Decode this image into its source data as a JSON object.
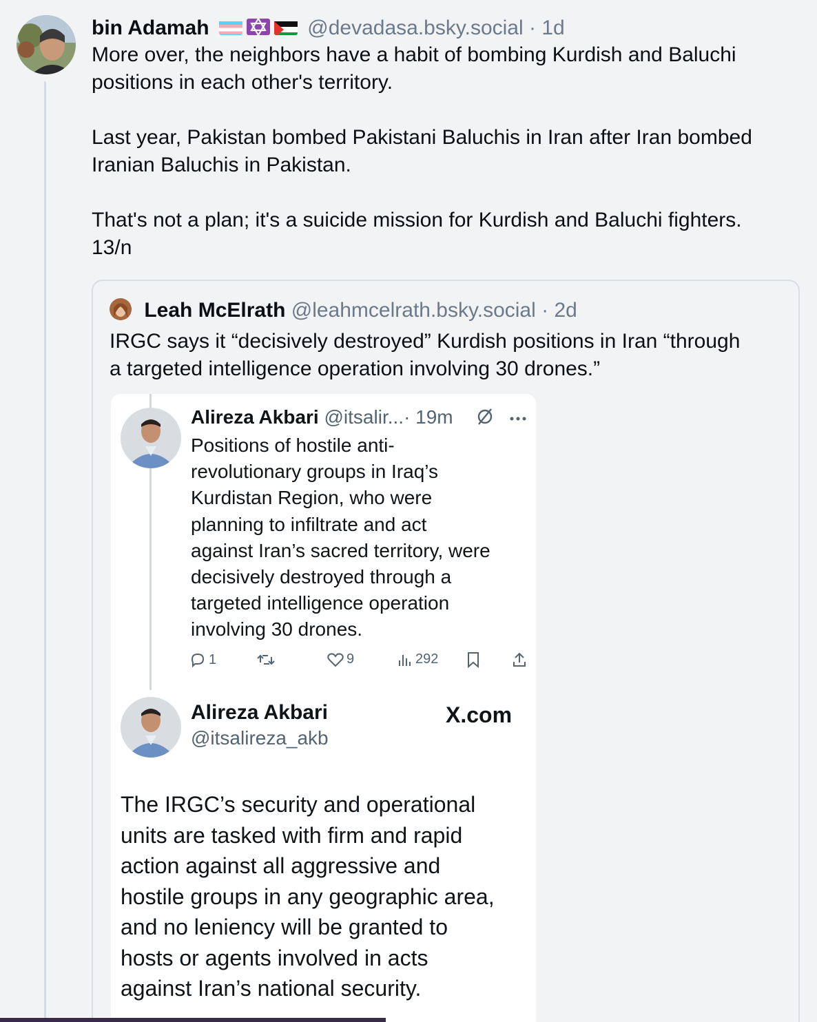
{
  "post": {
    "author": "bin Adamah",
    "handle": "@devadasa.bsky.social",
    "time": "· 1d",
    "flag_icons": [
      "transgender-flag-icon",
      "star-of-david-icon",
      "palestine-flag-icon"
    ],
    "body_lines": [
      "More over, the neighbors have a habit of bombing Kurdish and Baluchi",
      "positions in each other's territory.",
      "",
      "Last year, Pakistan bombed Pakistani Baluchis in Iran after Iran bombed",
      "Iranian Baluchis in Pakistan.",
      "",
      "That's not a plan; it's a suicide mission for Kurdish and Baluchi fighters.",
      "13/n"
    ]
  },
  "quote": {
    "author": "Leah McElrath",
    "handle": "@leahmcelrath.bsky.social",
    "time": "· 2d",
    "body_lines": [
      "IRGC says it “decisively destroyed” Kurdish positions in Iran “through",
      "a targeted intelligence operation involving 30 drones.”"
    ]
  },
  "embed": {
    "tweet1": {
      "name": "Alireza Akbari",
      "handle": "@itsalir...",
      "time": "· 19m",
      "body_lines": [
        "Positions of hostile anti-",
        "revolutionary groups in Iraq’s",
        "Kurdistan Region, who were",
        "planning to infiltrate and act",
        "against Iran’s sacred territory, were",
        "decisively destroyed through a",
        "targeted intelligence operation",
        "involving 30 drones."
      ],
      "actions": {
        "replies": "1",
        "likes": "9",
        "views": "292"
      }
    },
    "tweet2": {
      "name": "Alireza Akbari",
      "handle": "@itsalireza_akb",
      "site": "X.com",
      "body_lines": [
        "The IRGC’s security and operational",
        "units are tasked with firm and rapid",
        "action against all aggressive and",
        "hostile groups in any geographic area,",
        "and no leniency will be granted to",
        "hosts or agents involved in acts",
        "against Iran’s national security."
      ]
    }
  },
  "colors": {
    "background": "#f1f3f5",
    "muted_text": "#6b7a8a",
    "card_border": "#d8dee5",
    "x_muted": "#536471"
  }
}
